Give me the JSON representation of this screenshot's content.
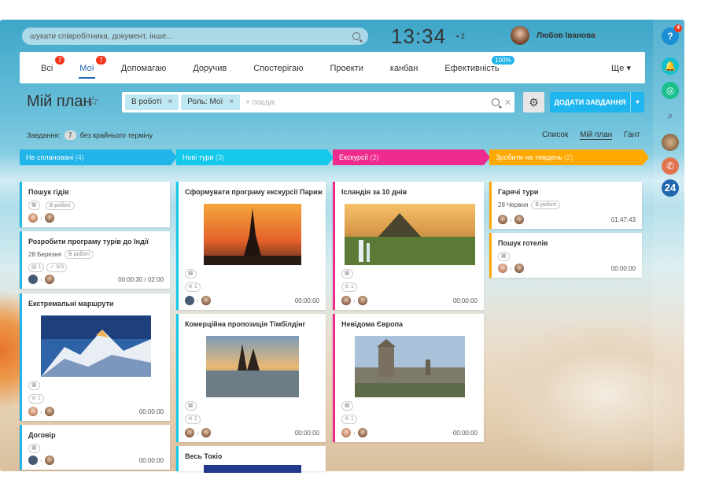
{
  "search": {
    "placeholder": "шукати співробітника, документ, інше..."
  },
  "clock": {
    "time": "13:34",
    "notifications": "2"
  },
  "user": {
    "name": "Любов Іванова"
  },
  "tabs": [
    {
      "label": "Всі",
      "badge": "7"
    },
    {
      "label": "Мої",
      "badge": "7"
    },
    {
      "label": "Допомагаю"
    },
    {
      "label": "Доручив"
    },
    {
      "label": "Спостерігаю"
    },
    {
      "label": "Проекти"
    },
    {
      "label": "канбан"
    },
    {
      "label": "Ефективність",
      "badge": "100%"
    }
  ],
  "more": "Ще",
  "page_title": "Мій план",
  "filter": {
    "chips": [
      "В роботі",
      "Роль: Мої"
    ],
    "placeholder": "+ пошук"
  },
  "add_button": "ДОДАТИ ЗАВДАННЯ",
  "counter": {
    "label": "Завдання:",
    "count": "7",
    "note": "без крайнього терміну"
  },
  "views": [
    "Список",
    "Мій план",
    "Гант"
  ],
  "columns": [
    {
      "title": "Не сплановані",
      "count": "(4)",
      "color": "#21b4e8"
    },
    {
      "title": "Нові тури",
      "count": "(3)",
      "color": "#13c8ea"
    },
    {
      "title": "Екскурсії",
      "count": "(2)",
      "color": "#ef2c8e"
    },
    {
      "title": "Зробити на тиждень",
      "count": "(2)",
      "color": "#ffa900"
    }
  ],
  "cards": {
    "c1": {
      "title": "Пошук гідів",
      "status": "В роботі"
    },
    "c2": {
      "title": "Розробити програму турів до Індії",
      "date": "28 Березня",
      "status": "В роботі",
      "files": "1",
      "checklist": "0/3",
      "time": "00:00:30 / 02:00"
    },
    "c3": {
      "title": "Екстремальні маршрути",
      "files": "1",
      "time": "00:00:00"
    },
    "c4": {
      "title": "Договір",
      "time": "00:00:00"
    },
    "c5": {
      "title": "Сформувати програму екскурсії Париж",
      "files": "1",
      "time": "00:00:00"
    },
    "c6": {
      "title": "Комерційна пропозиція Тімбілдінг",
      "files": "1",
      "time": "00:00:00"
    },
    "c7": {
      "title": "Весь Токіо"
    },
    "c8": {
      "title": "Ісландія за 10 днів",
      "files": "1",
      "time": "00:00:00"
    },
    "c9": {
      "title": "Невідома Європа",
      "files": "1",
      "time": "00:00:00"
    },
    "c10": {
      "title": "Гарячі тури",
      "date": "28 Червня",
      "status": "В роботі",
      "time": "01:47:43"
    },
    "c11": {
      "title": "Пошук готелів",
      "time": "00:00:00"
    }
  },
  "rail": {
    "help_badge": "4",
    "logo": "24"
  }
}
